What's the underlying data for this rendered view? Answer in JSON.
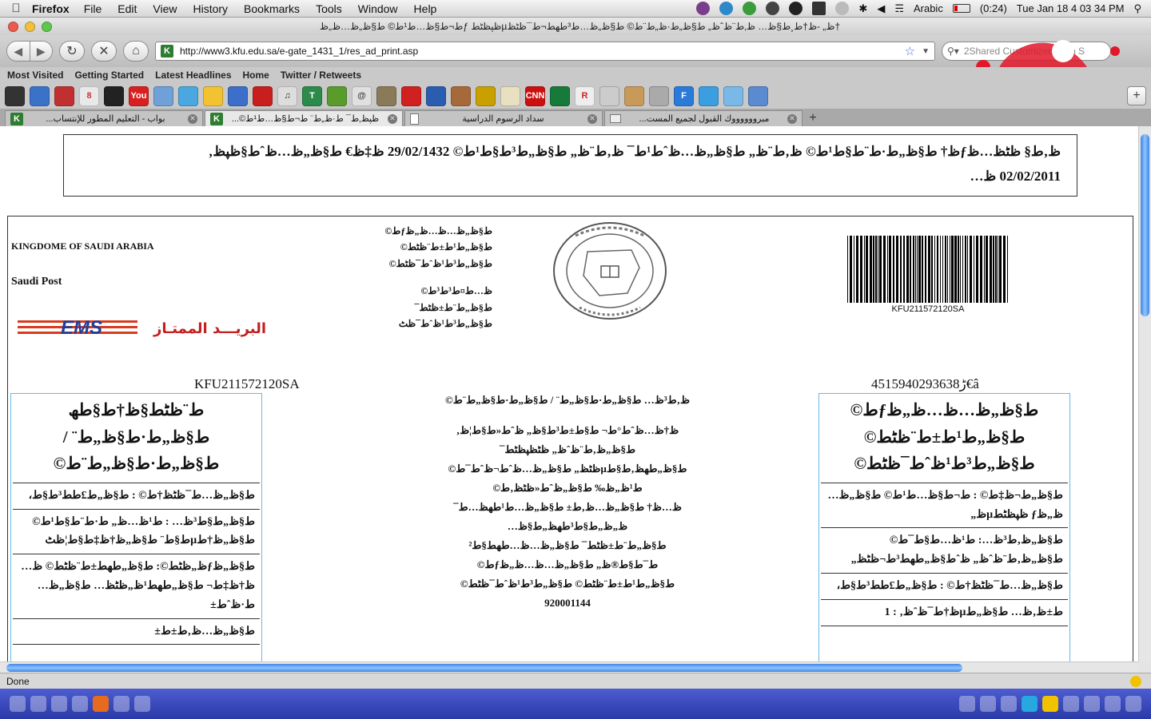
{
  "menubar": {
    "app_name": "Firefox",
    "items": [
      "File",
      "Edit",
      "View",
      "History",
      "Bookmarks",
      "Tools",
      "Window",
      "Help"
    ],
    "input_source": "Arabic",
    "battery": "(0:24)",
    "clock": "Tue Jan 18  4 03 34 PM"
  },
  "window": {
    "title": "ط¬ط§ظ…ط¹ط© ط§ظ„ظ…ظ„ظƒ ظپظٹطµظ„ -ظ†ط¸ط§ظ… ظ‚ط¨ظˆظ„ ط§ظ„ط·ظ„ط¨ط© ط§ظ„ظ…ط³طھط¬ط¯ظٹظ†"
  },
  "navigation": {
    "url": "http://www3.kfu.edu.sa/e-gate_1431_1/res_ad_print.asp",
    "search_placeholder": "2Shared Customized Web S"
  },
  "bookmarks": [
    "Most Visited",
    "Getting Started",
    "Latest Headlines",
    "Home",
    "Twitter / Retweets"
  ],
  "tabs": [
    {
      "label": "بواب - التعليم المطور للإنتساب...",
      "active": false
    },
    {
      "label": "ظپظ‚ط¯ ط·ظ„ط¨ ط¬ط§ظ…ط¹ط©...",
      "active": true
    },
    {
      "label": "سداد الرسوم الدراسية",
      "active": false
    },
    {
      "label": "مبرووووووك القبول لجميع المست...",
      "active": false
    }
  ],
  "status": "Done",
  "page": {
    "notice_line1": "ظ‚ط§ ظٹظ…ظƒظ† ط§ظ„ط·ط¨ط§ط¹ط© ظ‚ط¨ظ„ ط§ظ„ظ…ظˆط¹ط¯ ظ‚ط¨ظ„ ط§ظ„ط³ط§ط¹ط© 29/02/1432 ظ‡ظ€ ط§ظ„ظ…ظˆط§ظپظ‚",
    "notice_line2": "02/02/2011 ظ…",
    "kingdom": "KINGDOME OF SAUDI ARABIA",
    "saudi_post": "Saudi Post",
    "ems_logo": "EMS",
    "ems_arabic": "البريـــد الممتـاز",
    "addr_lines": [
      "ط§ظ„ظ…ظ…ظ„ظƒط©",
      "ط§ظ„ط¹ط±ط¨ظٹط©",
      "ط§ظ„ط³ط¹ظˆط¯ظٹط©",
      "ظ…ط¤ط³ط³ط© ط§ظ„ط¨ط±ظٹط¯",
      "ط§ظ„ط³ط¹ظˆط¯ظٹ"
    ],
    "barcode_text": "KFU211572120SA",
    "tracking_left": "KFU211572120SA",
    "tracking_right": "4515940293638ڑ€â",
    "left_col": {
      "heading": "ط¨ظٹط§ظ†ط§طھ ط§ظ„ط·ط§ظ„ط¨ / ط§ظ„ط·ط§ظ„ط¨ط©",
      "rows": [
        "ط§ظ„ظ…ط¯ظٹظ†ط© :  ط§ظ„ط£ط­ط³ط§ط،",
        "ط§ظ„ط§ط³ظ… :  ط¹ظ…ظ„ ط·ط¨ط§ط¹ط© ط§ظ„ظ†طµط§ط¨ ط§ظ„ظ†ظ‡ط§ط¦ظٹ",
        "ط§ظ„ظƒظ„ظٹط©:  ط§ظ„طھط±ط¨ظٹط© ظ…ظ†ظ‡ط¬ ط§ظ„طھط¹ظ„ظٹظ… ط§ظ„ظ…ط·ظˆط±",
        "ط§ظ„ظ…ظ‚ط±ط±"
      ]
    },
    "center_lines": [
      "ظ‚ط³ظ… ط§ظ„ط·ط§ظ„ط¨ / ط§ظ„ط·ط§ظ„ط¨ط©",
      "",
      "ظ†ظ…ظˆط°ط¬ ط§ط±ط³ط§ظ„ ظˆط«ط§ط¦ظ‚ ط§ظ„ظ‚ط¨ظˆظ„ ظٹظپظٹط¯",
      "ط§ظ„طھظ‚ط§طµظٹظ„ ط§ظ„ظ…ظˆط¬ظˆط¯ط© ط¹ظ„ظ‰ ط§ظ„ظˆط«ظٹظ‚ط©",
      "ظ…ظ† ط§ظ„ظ…ظ‚ط± ط§ظ„ظ…ط¹طھظ…ط¯ ظ„ظ„ط§ط³طھظ„ط§ظ…",
      "ط§ظ„ط¨ط±ظٹط¯ ط§ظ„ظ…ظ…طھط§ط² ط¯ط§ط®ظ„ ط§ظ„ظ…ظ…ظ„ظƒط©",
      "ط§ظ„ط¹ط±ط¨ظٹط© ط§ظ„ط³ط¹ظˆط¯ظٹط©",
      "920001144"
    ],
    "right_col": {
      "heading": "ط§ظ„ظ…ظ…ظ„ظƒط© ط§ظ„ط¹ط±ط¨ظٹط© ط§ظ„ط³ط¹ظˆط¯ظٹط©",
      "rows": [
        "ط§ظ„ط¬ظ‡ط© :  ط¬ط§ظ…ط¹ط© ط§ظ„ظ…ظ„ظƒ ظپظٹطµظ„",
        "ط§ظ„ظ‚ط³ظ…:  ط¹ظ…ط§ط¯ط© ط§ظ„ظ‚ط¨ظˆظ„ ظˆط§ظ„طھط³ط¬ظٹظ„",
        "ط§ظ„ظ…ط¯ظٹظ†ط© :  ط§ظ„ط£ط­ط³ط§ط،",
        "ط±ظ‚ظ… ط§ظ„طµظ†ط¯ظˆظ‚ :  1"
      ]
    }
  }
}
